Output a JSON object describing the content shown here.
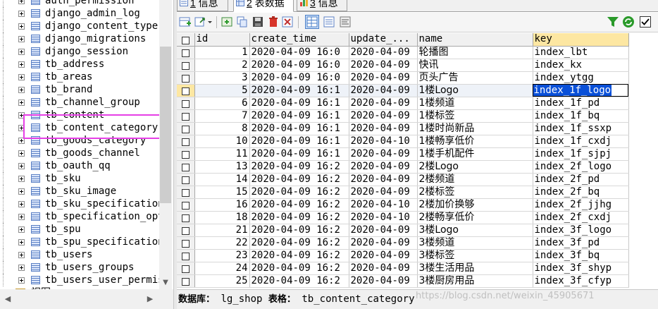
{
  "tree": {
    "items": [
      "auth_permission",
      "django_admin_log",
      "django_content_type",
      "django_migrations",
      "django_session",
      "tb_address",
      "tb_areas",
      "tb_brand",
      "tb_channel_group",
      "tb_content",
      "tb_content_category",
      "tb_goods_category",
      "tb_goods_channel",
      "tb_oauth_qq",
      "tb_sku",
      "tb_sku_image",
      "tb_sku_specification",
      "tb_specification_opt",
      "tb_spu",
      "tb_spu_specification",
      "tb_users",
      "tb_users_groups",
      "tb_users_user_permis"
    ],
    "last_folder": "视图",
    "scroll_down": "▼",
    "scroll_left": "◀",
    "scroll_right": "▶"
  },
  "tabs": [
    {
      "num": "1",
      "label": "信息"
    },
    {
      "num": "2",
      "label": "表数据"
    },
    {
      "num": "3",
      "label": "信息"
    }
  ],
  "grid": {
    "columns": [
      "id",
      "create_time",
      "update_...",
      "name",
      "key"
    ],
    "rows": [
      {
        "id": "1",
        "create_time": "2020-04-09 16:0",
        "update_time": "2020-04-09",
        "name": "轮播图",
        "key": "index_lbt"
      },
      {
        "id": "2",
        "create_time": "2020-04-09 16:0",
        "update_time": "2020-04-09",
        "name": "快讯",
        "key": "index_kx"
      },
      {
        "id": "3",
        "create_time": "2020-04-09 16:0",
        "update_time": "2020-04-09",
        "name": "页头广告",
        "key": "index_ytgg"
      },
      {
        "id": "5",
        "create_time": "2020-04-09 16:1",
        "update_time": "2020-04-09",
        "name": "1楼Logo",
        "key": "index_1f_logo"
      },
      {
        "id": "6",
        "create_time": "2020-04-09 16:1",
        "update_time": "2020-04-09",
        "name": "1楼频道",
        "key": "index_1f_pd"
      },
      {
        "id": "7",
        "create_time": "2020-04-09 16:1",
        "update_time": "2020-04-09",
        "name": "1楼标签",
        "key": "index_1f_bq"
      },
      {
        "id": "8",
        "create_time": "2020-04-09 16:1",
        "update_time": "2020-04-09",
        "name": "1楼时尚新品",
        "key": "index_1f_ssxp"
      },
      {
        "id": "10",
        "create_time": "2020-04-09 16:1",
        "update_time": "2020-04-10",
        "name": "1楼畅享低价",
        "key": "index_1f_cxdj"
      },
      {
        "id": "11",
        "create_time": "2020-04-09 16:1",
        "update_time": "2020-04-09",
        "name": "1楼手机配件",
        "key": "index_1f_sjpj"
      },
      {
        "id": "13",
        "create_time": "2020-04-09 16:2",
        "update_time": "2020-04-09",
        "name": "2楼Logo",
        "key": "index_2f_logo"
      },
      {
        "id": "14",
        "create_time": "2020-04-09 16:2",
        "update_time": "2020-04-09",
        "name": "2楼频道",
        "key": "index_2f_pd"
      },
      {
        "id": "15",
        "create_time": "2020-04-09 16:2",
        "update_time": "2020-04-09",
        "name": "2楼标签",
        "key": "index_2f_bq"
      },
      {
        "id": "16",
        "create_time": "2020-04-09 16:2",
        "update_time": "2020-04-10",
        "name": "2楼加价换够",
        "key": "index_2f_jjhg"
      },
      {
        "id": "18",
        "create_time": "2020-04-09 16:2",
        "update_time": "2020-04-10",
        "name": "2楼畅享低价",
        "key": "index_2f_cxdj"
      },
      {
        "id": "21",
        "create_time": "2020-04-09 16:2",
        "update_time": "2020-04-09",
        "name": "3楼Logo",
        "key": "index_3f_logo"
      },
      {
        "id": "22",
        "create_time": "2020-04-09 16:2",
        "update_time": "2020-04-09",
        "name": "3楼频道",
        "key": "index_3f_pd"
      },
      {
        "id": "23",
        "create_time": "2020-04-09 16:2",
        "update_time": "2020-04-09",
        "name": "3楼标签",
        "key": "index_3f_bq"
      },
      {
        "id": "24",
        "create_time": "2020-04-09 16:2",
        "update_time": "2020-04-09",
        "name": "3楼生活用品",
        "key": "index_3f_shyp"
      },
      {
        "id": "25",
        "create_time": "2020-04-09 16:2",
        "update_time": "2020-04-09",
        "name": "3楼厨房用品",
        "key": "index_3f_cfyp"
      }
    ],
    "selected_row_index": 3,
    "editing_key_row_index": 3
  },
  "statusbar": {
    "db_label": "数据库：",
    "db_value": "lg_shop",
    "table_label": "表格：",
    "table_value": "tb_content_category"
  },
  "watermark": "https://blog.csdn.net/weixin_45905671",
  "colors": {
    "highlight_box": "#e640e6",
    "selection_blue": "#0a50d8",
    "header_highlight": "#fde7a2"
  }
}
